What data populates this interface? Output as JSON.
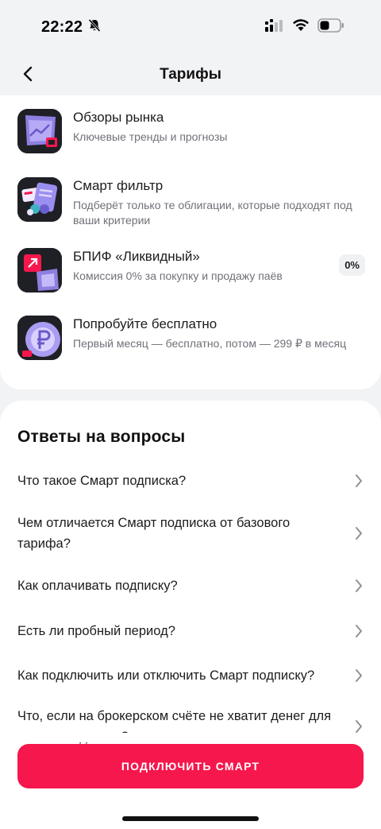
{
  "status_bar": {
    "time": "22:22"
  },
  "nav": {
    "title": "Тарифы"
  },
  "features": [
    {
      "title": "Обзоры рынка",
      "subtitle": "Ключевые тренды и прогнозы"
    },
    {
      "title": "Смарт фильтр",
      "subtitle": "Подберёт только те облигации, которые подходят под ваши критерии"
    },
    {
      "title": "БПИФ «Ликвидный»",
      "subtitle": "Комиссия 0% за покупку и продажу паёв",
      "badge": "0%"
    },
    {
      "title": "Попробуйте бесплатно",
      "subtitle": "Первый месяц — бесплатно, потом — 299 ₽ в месяц"
    }
  ],
  "faq": {
    "heading": "Ответы на вопросы",
    "items": [
      "Что такое Смарт подписка?",
      "Чем отличается Смарт подписка от базового тарифа?",
      "Как оплачивать подписку?",
      "Есть ли пробный период?",
      "Как подключить или отключить Смарт подписку?",
      "Что, если на брокерском счёте не хватит денег для оплаты подписки?"
    ]
  },
  "cta": {
    "label": "ПОДКЛЮЧИТЬ СМАРТ"
  },
  "colors": {
    "accent": "#f6174d",
    "background": "#f2f3f5",
    "card": "#ffffff"
  },
  "icons": {
    "back": "chevron-left-icon",
    "faq_item": "chevron-right-icon",
    "silent": "bell-slash-icon",
    "signal": "cellular-signal-icon",
    "wifi": "wifi-icon",
    "battery": "battery-icon"
  }
}
